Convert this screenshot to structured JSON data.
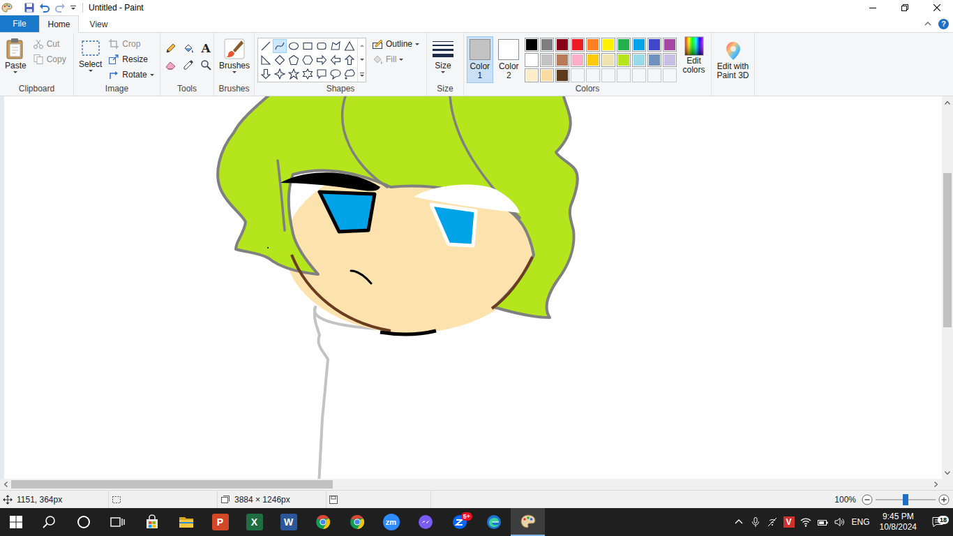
{
  "window": {
    "title": "Untitled - Paint"
  },
  "file_menu": {
    "label": "File"
  },
  "ribbon_tabs": [
    {
      "label": "Home",
      "selected": true
    },
    {
      "label": "View",
      "selected": false
    }
  ],
  "help": "?",
  "clipboard": {
    "label": "Clipboard",
    "paste": "Paste",
    "cut": {
      "label": "Cut",
      "disabled": true
    },
    "copy": {
      "label": "Copy",
      "disabled": true
    }
  },
  "image": {
    "label": "Image",
    "select": "Select",
    "crop": {
      "label": "Crop",
      "disabled": true
    },
    "resize": {
      "label": "Resize",
      "disabled": false
    },
    "rotate": {
      "label": "Rotate",
      "disabled": false
    }
  },
  "tools": {
    "label": "Tools",
    "items": [
      {
        "kind": "pencil"
      },
      {
        "kind": "fill"
      },
      {
        "kind": "text",
        "glyph": "A"
      },
      {
        "kind": "eraser"
      },
      {
        "kind": "picker"
      },
      {
        "kind": "magnifier"
      }
    ]
  },
  "brushes": {
    "label": "Brushes"
  },
  "shapes": {
    "label": "Shapes",
    "items": [
      {
        "kind": "line",
        "selected": false
      },
      {
        "kind": "curve",
        "selected": true
      },
      {
        "kind": "oval",
        "selected": false
      },
      {
        "kind": "rect",
        "selected": false
      },
      {
        "kind": "roundrect",
        "selected": false
      },
      {
        "kind": "polygon",
        "selected": false
      },
      {
        "kind": "triangle",
        "selected": false
      },
      {
        "kind": "righttriangle",
        "selected": false
      },
      {
        "kind": "diamond",
        "selected": false
      },
      {
        "kind": "pentagon",
        "selected": false
      },
      {
        "kind": "hexagon",
        "selected": false
      },
      {
        "kind": "arrowright",
        "selected": false
      },
      {
        "kind": "arrowleft",
        "selected": false
      },
      {
        "kind": "arrowup",
        "selected": false
      },
      {
        "kind": "arrowdown",
        "selected": false
      },
      {
        "kind": "star4",
        "selected": false
      },
      {
        "kind": "star5",
        "selected": false
      },
      {
        "kind": "star6",
        "selected": false
      },
      {
        "kind": "calloutrect",
        "selected": false
      },
      {
        "kind": "calloutoval",
        "selected": false
      },
      {
        "kind": "calloutcloud",
        "selected": false
      }
    ],
    "outline": {
      "label": "Outline",
      "disabled": false
    },
    "fill": {
      "label": "Fill",
      "disabled": true
    }
  },
  "size": {
    "label": "Size"
  },
  "colors": {
    "label": "Colors",
    "color1": {
      "label": "Color 1",
      "color": "#c3c3c3",
      "selected": true
    },
    "color2": {
      "label": "Color 2",
      "color": "#ffffff",
      "selected": false
    },
    "palette": [
      {
        "color": "#000000"
      },
      {
        "color": "#7f7f7f"
      },
      {
        "color": "#880015"
      },
      {
        "color": "#ed1c24"
      },
      {
        "color": "#ff7f27"
      },
      {
        "color": "#fff200"
      },
      {
        "color": "#22b14c"
      },
      {
        "color": "#00a2e8"
      },
      {
        "color": "#3f48cc"
      },
      {
        "color": "#a349a4"
      },
      {
        "color": "#ffffff"
      },
      {
        "color": "#c3c3c3"
      },
      {
        "color": "#b97a57"
      },
      {
        "color": "#ffaec9"
      },
      {
        "color": "#ffc90e"
      },
      {
        "color": "#efe4b0"
      },
      {
        "color": "#b5e61d"
      },
      {
        "color": "#99d9ea"
      },
      {
        "color": "#7092be"
      },
      {
        "color": "#c8bfe7"
      },
      {
        "color": "#fdecc9"
      },
      {
        "color": "#fbdca3"
      },
      {
        "color": "#5e3a1e"
      },
      {
        "empty": true
      },
      {
        "empty": true
      },
      {
        "empty": true
      },
      {
        "empty": true
      },
      {
        "empty": true
      },
      {
        "empty": true
      },
      {
        "empty": true
      }
    ],
    "edit": "Edit colors"
  },
  "paint3d": {
    "label": "Edit with Paint 3D"
  },
  "canvas": {
    "vertical_scroll": {
      "offset": 0.18,
      "level": 0.43
    },
    "horizontal_scroll": {
      "offset": 0,
      "level": 0.35
    }
  },
  "status_bar": {
    "position": "1151, 364px",
    "canvas_size": "3884 × 1246px",
    "zoom": "100%",
    "zoom_level": 0.5
  },
  "taskbar": {
    "apps": [
      {
        "kind": "start",
        "selected": false
      },
      {
        "kind": "search",
        "selected": false
      },
      {
        "kind": "cortana",
        "selected": false
      },
      {
        "kind": "taskview",
        "selected": false
      },
      {
        "kind": "store",
        "selected": false
      },
      {
        "kind": "explorer",
        "selected": false
      },
      {
        "kind": "powerpoint",
        "glyph": "P",
        "selected": false
      },
      {
        "kind": "excel",
        "glyph": "X",
        "selected": false
      },
      {
        "kind": "word",
        "glyph": "W",
        "selected": false
      },
      {
        "kind": "chrome",
        "selected": false
      },
      {
        "kind": "chrome",
        "selected": false
      },
      {
        "kind": "zoom",
        "glyph": "zm",
        "selected": false
      },
      {
        "kind": "messenger",
        "selected": false
      },
      {
        "kind": "zalo",
        "badge": "5+",
        "selected": false
      },
      {
        "kind": "edge",
        "selected": false
      },
      {
        "kind": "paint",
        "selected": true
      }
    ],
    "tray": {
      "items": [
        {
          "kind": "caret"
        },
        {
          "kind": "mic"
        },
        {
          "kind": "network"
        },
        {
          "kind": "vivaldi",
          "glyph": "V"
        },
        {
          "kind": "wifi"
        },
        {
          "kind": "battery"
        },
        {
          "kind": "volume"
        }
      ],
      "language": "ENG",
      "time": "9:45 PM",
      "date": "10/8/2024",
      "notifications": "18"
    }
  }
}
